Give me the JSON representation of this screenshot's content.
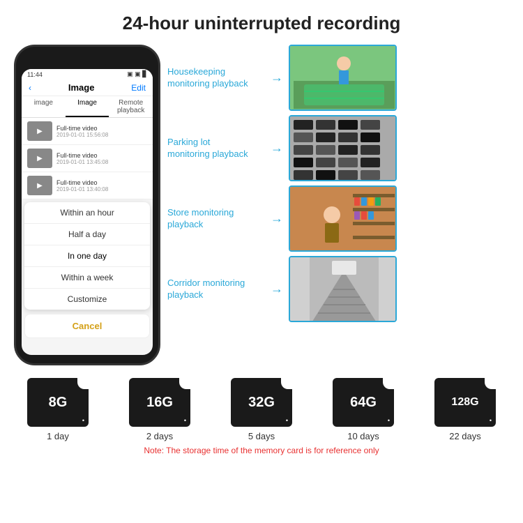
{
  "header": {
    "title": "24-hour uninterrupted recording"
  },
  "phone": {
    "status_time": "11:44",
    "nav_back": "‹",
    "nav_title": "Image",
    "nav_edit": "Edit",
    "tabs": [
      "image",
      "Image",
      "Remote playback"
    ],
    "list_items": [
      {
        "label": "Full-time video",
        "date": "2019-01-01 15:56:08"
      },
      {
        "label": "Full-time video",
        "date": "2019-01-01 13:45:08"
      },
      {
        "label": "Full-time video",
        "date": "2019-01-01 13:40:08"
      }
    ],
    "dropdown_items": [
      "Within an hour",
      "Half a day",
      "In one day",
      "Within a week",
      "Customize"
    ],
    "cancel_label": "Cancel"
  },
  "monitoring": [
    {
      "label": "Housekeeping\nmonitoring playback",
      "img_class": "img-housekeeping"
    },
    {
      "label": "Parking lot\nmonitoring playback",
      "img_class": "img-parking"
    },
    {
      "label": "Store monitoring\nplayback",
      "img_class": "img-store"
    },
    {
      "label": "Corridor monitoring\nplayback",
      "img_class": "img-corridor"
    }
  ],
  "sd_cards": [
    {
      "size": "8G",
      "days": "1 day"
    },
    {
      "size": "16G",
      "days": "2 days"
    },
    {
      "size": "32G",
      "days": "5 days"
    },
    {
      "size": "64G",
      "days": "10 days"
    },
    {
      "size": "128G",
      "days": "22 days"
    }
  ],
  "note": "Note: The storage time of the memory card is for reference only",
  "colors": {
    "accent_blue": "#2aa8d8",
    "accent_gold": "#d4a017",
    "note_red": "#e83030",
    "card_bg": "#1a1a1a"
  }
}
